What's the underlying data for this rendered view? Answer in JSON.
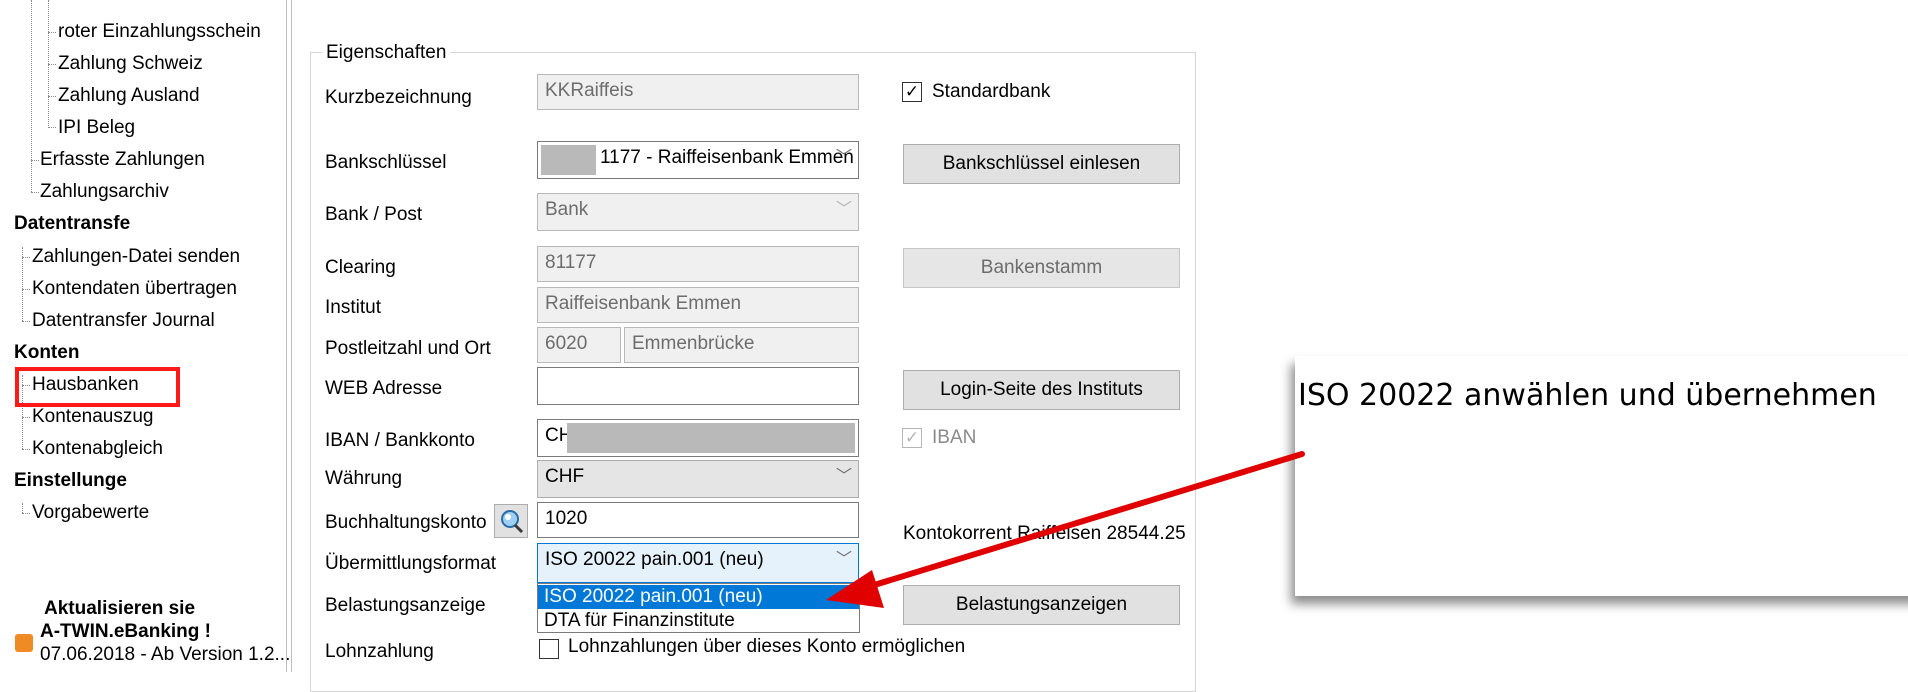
{
  "tree": {
    "items": [
      {
        "label": "roter Einzahlungsschein"
      },
      {
        "label": "Zahlung Schweiz"
      },
      {
        "label": "Zahlung Ausland"
      },
      {
        "label": "IPI Beleg"
      },
      {
        "label": "Erfasste Zahlungen"
      },
      {
        "label": "Zahlungsarchiv"
      },
      {
        "label": "Datentransfe"
      },
      {
        "label": "Zahlungen-Datei senden"
      },
      {
        "label": "Kontendaten übertragen"
      },
      {
        "label": "Datentransfer Journal"
      },
      {
        "label": "Konten"
      },
      {
        "label": "Hausbanken"
      },
      {
        "label": "Kontenauszug"
      },
      {
        "label": "Kontenabgleich"
      },
      {
        "label": "Einstellunge"
      },
      {
        "label": "Vorgabewerte"
      }
    ],
    "update_notice": {
      "line1": "Aktualisieren sie",
      "line2": "A-TWIN.eBanking !",
      "line3": "07.06.2018 - Ab Version 1.2..."
    }
  },
  "form": {
    "group_title": "Eigenschaften",
    "kurzbezeichnung": {
      "label": "Kurzbezeichnung",
      "value": "KKRaiffeis"
    },
    "standardbank": {
      "label": "Standardbank",
      "checked": true
    },
    "bankschluessel": {
      "label": "Bankschlüssel",
      "value": "1177 - Raiffeisenbank Emmen"
    },
    "bankschluessel_button": "Bankschlüssel einlesen",
    "bank_post": {
      "label": "Bank / Post",
      "value": "Bank"
    },
    "clearing": {
      "label": "Clearing",
      "value": "81177"
    },
    "bankenstamm_button": "Bankenstamm",
    "institut": {
      "label": "Institut",
      "value": "Raiffeisenbank Emmen"
    },
    "plz_ort": {
      "label": "Postleitzahl und Ort",
      "plz": "6020",
      "ort": "Emmenbrücke"
    },
    "web": {
      "label": "WEB Adresse",
      "value": ""
    },
    "login_button": "Login-Seite des Instituts",
    "iban": {
      "label": "IBAN / Bankkonto",
      "value": "CH",
      "iban_check_label": "IBAN",
      "iban_checked": true
    },
    "waehrung": {
      "label": "Währung",
      "value": "CHF"
    },
    "buchhaltungskonto": {
      "label": "Buchhaltungskonto",
      "value": "1020"
    },
    "kontokorrent_text": "Kontokorrent Raiffeisen 28544.25",
    "uebermittlungsformat": {
      "label": "Übermittlungsformat",
      "value": "ISO 20022 pain.001 (neu)",
      "options": [
        "ISO 20022 pain.001 (neu)",
        "DTA für Finanzinstitute"
      ]
    },
    "belastungsanzeige": {
      "label": "Belastungsanzeige"
    },
    "belastungsanzeigen_button": "Belastungsanzeigen",
    "lohnzahlung": {
      "label": "Lohnzahlung",
      "checkbox_label": "Lohnzahlungen über dieses Konto ermöglichen",
      "checked": false
    }
  },
  "callout": {
    "text": "ISO 20022 anwählen und übernehmen"
  },
  "colors": {
    "highlight_box": "#ff1a1a",
    "arrow": "#e00000",
    "selection": "#0078d7",
    "rss": "#f08a24"
  }
}
